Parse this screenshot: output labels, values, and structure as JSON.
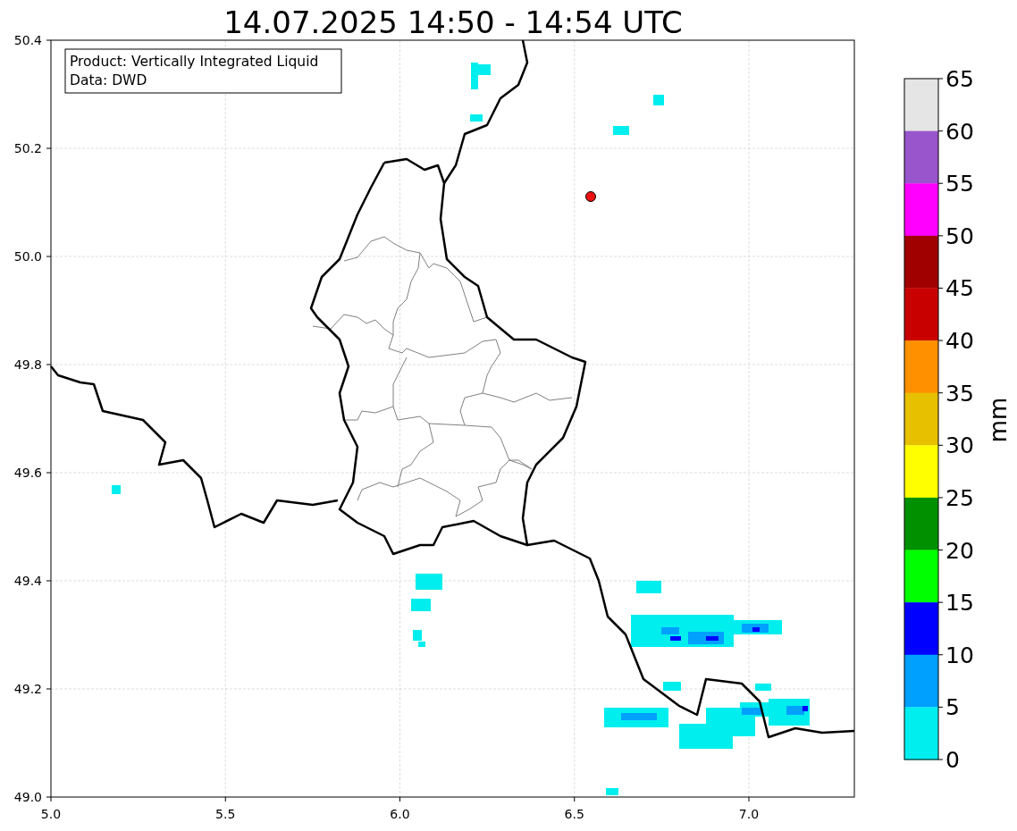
{
  "title": "14.07.2025 14:50 - 14:54 UTC",
  "legend": [
    "Product: Vertically Integrated Liquid",
    "Data: DWD"
  ],
  "x_ticks": [
    "5.0",
    "5.5",
    "6.0",
    "6.5",
    "7.0"
  ],
  "y_ticks": [
    "50.4",
    "50.2",
    "50.0",
    "49.8",
    "49.6",
    "49.4",
    "49.2",
    "49.0"
  ],
  "colorbar": {
    "label": "mm",
    "ticks": [
      "65",
      "60",
      "55",
      "50",
      "45",
      "40",
      "35",
      "30",
      "25",
      "20",
      "15",
      "10",
      "5",
      "0"
    ],
    "segments": [
      {
        "color": "#e5e5e5"
      },
      {
        "color": "#9955cc"
      },
      {
        "color": "#ff00ff"
      },
      {
        "color": "#a00000"
      },
      {
        "color": "#c80000"
      },
      {
        "color": "#ff9000"
      },
      {
        "color": "#e7c000"
      },
      {
        "color": "#ffff00"
      },
      {
        "color": "#009000"
      },
      {
        "color": "#00ff00"
      },
      {
        "color": "#0000ff"
      },
      {
        "color": "#00a0ff"
      },
      {
        "color": "#00eeee"
      }
    ]
  }
}
